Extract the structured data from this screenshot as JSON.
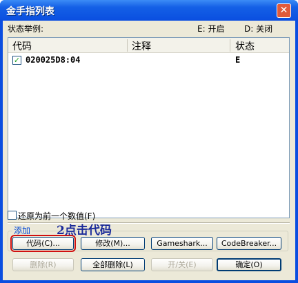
{
  "window": {
    "title": "金手指列表",
    "close_symbol": "✕"
  },
  "status_legend": {
    "label": "状态举例:",
    "on": "E: 开启",
    "off": "D: 关闭"
  },
  "table": {
    "columns": [
      "代码",
      "注释",
      "状态"
    ],
    "rows": [
      {
        "checked": true,
        "check_symbol": "✓",
        "code": "020025D8:04",
        "note": "",
        "status": "E"
      }
    ]
  },
  "restore_checkbox": {
    "label": "还原为前一个数值(F)",
    "checked": false
  },
  "add_group": {
    "label": "添加",
    "buttons": {
      "code": "代码(C)...",
      "modify": "修改(M)...",
      "gameshark": "Gameshark...",
      "codebreaker": "CodeBreaker..."
    }
  },
  "bottom_buttons": {
    "delete": "删除(R)",
    "delete_all": "全部删除(L)",
    "toggle": "开/关(E)",
    "ok": "确定(O)"
  },
  "annotation": "2点击代码",
  "colors": {
    "highlight_border": "#d01010",
    "annotation_text": "#1a2a9a",
    "title_bar": "#0a4ee0"
  }
}
